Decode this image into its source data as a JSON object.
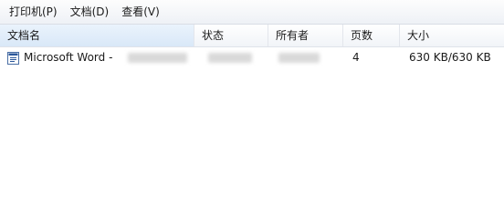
{
  "menubar": {
    "items": [
      {
        "label": "打印机(P)"
      },
      {
        "label": "文档(D)"
      },
      {
        "label": "查看(V)"
      }
    ]
  },
  "columns": {
    "name": "文档名",
    "status": "状态",
    "owner": "所有者",
    "pages": "页数",
    "size": "大小"
  },
  "jobs": [
    {
      "name": "Microsoft Word -",
      "pages": "4",
      "size": "630 KB/630 KB",
      "icon": "word-document-icon"
    }
  ]
}
